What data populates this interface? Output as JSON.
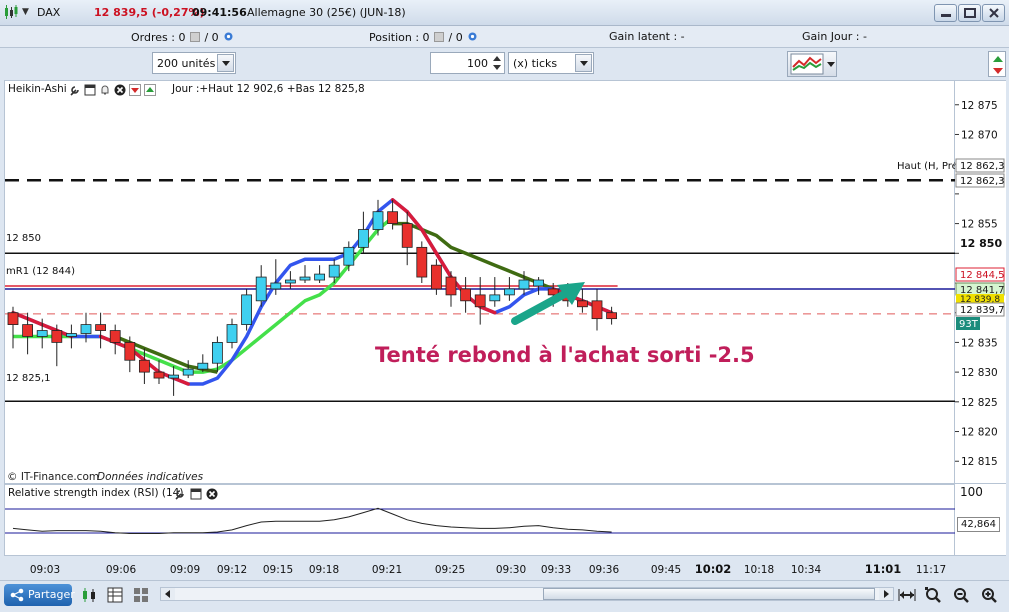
{
  "titlebar": {
    "symbol": "DAX",
    "price": "12 839,5 (-0,27%)",
    "time": "09:41:56",
    "instrument": "Allemagne 30 (25€) (JUN-18)"
  },
  "status": {
    "orders_label": "Ordres :",
    "orders_value": "0",
    "orders_sep": "/",
    "orders_value2": "0",
    "position_label": "Position :",
    "position_value": "0",
    "position_sep": "/",
    "position_value2": "0",
    "latent_label": "Gain latent :",
    "latent_value": "-",
    "day_label": "Gain Jour :",
    "day_value": "-"
  },
  "toolbar": {
    "units": "200 unités",
    "quantity": "100",
    "ticks": "(x) ticks"
  },
  "chart": {
    "indicator_name": "Heikin-Ashi",
    "day_info": "Jour :+Haut 12 902,6 +Bas 12 825,8",
    "copyright": "© IT-Finance.com",
    "data_note": "Données indicatives",
    "annotation": "Tenté rebond à l'achat sorti -2.5",
    "level_high_label": "Haut (H, Pré)",
    "level_12850_label": "12 850",
    "level_mr1_label": "mR1 (12 844)",
    "level_12825_label": "12 825,1"
  },
  "price_axis": {
    "ticks": [
      "12 875",
      "12 870",
      "12 865",
      "12 860",
      "12 855",
      "12 850",
      "12 845",
      "12 840",
      "12 835",
      "12 830",
      "12 825",
      "12 820",
      "12 815"
    ],
    "tag_high": "12 862,3",
    "tag_high2": "12 862,3",
    "tag_12850": "12 850",
    "tag_mr1": "12 844,5",
    "tag_green": "12 841,7",
    "tag_yellow": "12 839,8",
    "tag_last": "12 839,7",
    "tag_93t": "93T"
  },
  "rsi": {
    "label": "Relative strength index (RSI) (14)",
    "scale_top": "100",
    "value": "42,864"
  },
  "time_axis": {
    "labels": [
      "09:03",
      "09:06",
      "09:09",
      "09:12",
      "09:15",
      "09:18",
      "09:21",
      "09:25",
      "09:30",
      "09:33",
      "09:36",
      "09:45",
      "10:02",
      "10:18",
      "10:34",
      "11:01",
      "11:17"
    ],
    "bold": [
      "10:02",
      "11:01"
    ]
  },
  "bottombar": {
    "share_label": "Partager"
  },
  "chart_data": {
    "type": "candlestick",
    "ylim": [
      12811,
      12879
    ],
    "levels": [
      {
        "name": "Haut (H, Pré)",
        "value": 12862.3,
        "style": "dashed",
        "color": "#111111"
      },
      {
        "name": "12 850",
        "value": 12850,
        "style": "solid",
        "color": "#111111"
      },
      {
        "name": "mR1 (12 844)",
        "value": 12844.5,
        "style": "solid",
        "color": "#dd2233"
      },
      {
        "name": "blue",
        "value": 12844,
        "style": "solid",
        "color": "#1a1a9a"
      },
      {
        "name": "last",
        "value": 12839.8,
        "style": "dashed",
        "color": "#e05a5a"
      },
      {
        "name": "12 825,1",
        "value": 12825.1,
        "style": "solid",
        "color": "#111111"
      }
    ],
    "candles": [
      {
        "o": 12840,
        "c": 12838,
        "h": 12841,
        "l": 12834,
        "up": false
      },
      {
        "o": 12838,
        "c": 12836,
        "h": 12840,
        "l": 12833,
        "up": false
      },
      {
        "o": 12836,
        "c": 12837,
        "h": 12839,
        "l": 12834,
        "up": true
      },
      {
        "o": 12837,
        "c": 12835,
        "h": 12838,
        "l": 12831,
        "up": false
      },
      {
        "o": 12836,
        "c": 12836.5,
        "h": 12838,
        "l": 12834,
        "up": true
      },
      {
        "o": 12836.5,
        "c": 12838,
        "h": 12840,
        "l": 12835,
        "up": true
      },
      {
        "o": 12838,
        "c": 12837,
        "h": 12840,
        "l": 12834,
        "up": false
      },
      {
        "o": 12837,
        "c": 12835,
        "h": 12838,
        "l": 12833,
        "up": false
      },
      {
        "o": 12835,
        "c": 12832,
        "h": 12836,
        "l": 12830,
        "up": false
      },
      {
        "o": 12832,
        "c": 12830,
        "h": 12834,
        "l": 12828,
        "up": false
      },
      {
        "o": 12830,
        "c": 12829,
        "h": 12832,
        "l": 12828,
        "up": false
      },
      {
        "o": 12829,
        "c": 12829.5,
        "h": 12831,
        "l": 12826,
        "up": true
      },
      {
        "o": 12829.5,
        "c": 12830.5,
        "h": 12832,
        "l": 12829,
        "up": true
      },
      {
        "o": 12830.5,
        "c": 12831.5,
        "h": 12833,
        "l": 12830,
        "up": true
      },
      {
        "o": 12831.5,
        "c": 12835,
        "h": 12836,
        "l": 12830,
        "up": true
      },
      {
        "o": 12835,
        "c": 12838,
        "h": 12839,
        "l": 12834,
        "up": true
      },
      {
        "o": 12838,
        "c": 12843,
        "h": 12844,
        "l": 12837,
        "up": true
      },
      {
        "o": 12842,
        "c": 12846,
        "h": 12848,
        "l": 12841,
        "up": true
      },
      {
        "o": 12844,
        "c": 12845,
        "h": 12849,
        "l": 12843,
        "up": true
      },
      {
        "o": 12845,
        "c": 12845.5,
        "h": 12847,
        "l": 12844,
        "up": true
      },
      {
        "o": 12845.5,
        "c": 12846,
        "h": 12848,
        "l": 12845,
        "up": true
      },
      {
        "o": 12845.5,
        "c": 12846.5,
        "h": 12848,
        "l": 12845,
        "up": true
      },
      {
        "o": 12846,
        "c": 12848,
        "h": 12849,
        "l": 12845,
        "up": true
      },
      {
        "o": 12848,
        "c": 12851,
        "h": 12852,
        "l": 12847,
        "up": true
      },
      {
        "o": 12851,
        "c": 12854,
        "h": 12857,
        "l": 12850,
        "up": true
      },
      {
        "o": 12854,
        "c": 12857,
        "h": 12859,
        "l": 12853,
        "up": true
      },
      {
        "o": 12857,
        "c": 12855,
        "h": 12859,
        "l": 12854,
        "up": false
      },
      {
        "o": 12855,
        "c": 12851,
        "h": 12857,
        "l": 12848,
        "up": false
      },
      {
        "o": 12851,
        "c": 12846,
        "h": 12852,
        "l": 12845,
        "up": false
      },
      {
        "o": 12848,
        "c": 12844,
        "h": 12849,
        "l": 12843,
        "up": false
      },
      {
        "o": 12846,
        "c": 12843,
        "h": 12847,
        "l": 12841,
        "up": false
      },
      {
        "o": 12844,
        "c": 12842,
        "h": 12846,
        "l": 12840,
        "up": false
      },
      {
        "o": 12843,
        "c": 12841,
        "h": 12846,
        "l": 12838,
        "up": false
      },
      {
        "o": 12842,
        "c": 12843,
        "h": 12846,
        "l": 12841,
        "up": true
      },
      {
        "o": 12843,
        "c": 12844,
        "h": 12846,
        "l": 12842,
        "up": true
      },
      {
        "o": 12844,
        "c": 12845.5,
        "h": 12847,
        "l": 12843,
        "up": true
      },
      {
        "o": 12845.5,
        "c": 12844.5,
        "h": 12846,
        "l": 12843,
        "up": true
      },
      {
        "o": 12844,
        "c": 12843,
        "h": 12845,
        "l": 12841,
        "up": false
      },
      {
        "o": 12843,
        "c": 12842,
        "h": 12845,
        "l": 12841,
        "up": false
      },
      {
        "o": 12842,
        "c": 12841,
        "h": 12844,
        "l": 12840,
        "up": false
      },
      {
        "o": 12842,
        "c": 12839,
        "h": 12844,
        "l": 12837,
        "up": false
      },
      {
        "o": 12840,
        "c": 12839,
        "h": 12841,
        "l": 12838,
        "up": false
      }
    ],
    "series": [
      {
        "name": "green-ma",
        "color": "#44e04a",
        "values": [
          12836,
          12836,
          12836,
          12836,
          12836,
          12836,
          12836,
          12835,
          12834,
          12833,
          12832,
          12831,
          12830,
          12830,
          12830.5,
          12832,
          12834,
          12836,
          12838,
          12840,
          12842,
          12843,
          12845,
          12848,
          12851,
          12854,
          12856,
          null,
          null,
          null,
          null,
          null,
          null,
          null,
          null,
          null,
          null,
          null,
          null,
          null,
          null,
          null
        ]
      },
      {
        "name": "darkgreen-ma",
        "color": "#3f6b12",
        "values": [
          null,
          null,
          null,
          null,
          null,
          null,
          null,
          12836,
          12835,
          12834,
          12833,
          12832,
          12831,
          12830.5,
          12830,
          null,
          null,
          null,
          null,
          null,
          null,
          null,
          null,
          null,
          null,
          null,
          12855,
          12855,
          12854,
          12853,
          12851,
          12850,
          12849,
          12848,
          12847,
          12846,
          12845,
          12844,
          12843,
          12842,
          12841,
          null
        ]
      },
      {
        "name": "red-blue-ma",
        "color": "#3355ee",
        "values": [
          12840,
          12839,
          12838,
          12837,
          12836,
          12836,
          12836,
          12835,
          12834,
          12832,
          12830,
          12829,
          12828,
          12828,
          12829,
          12832,
          12836,
          12841,
          12845,
          12848,
          12849,
          12849,
          12849,
          12850,
          12853,
          12857,
          12859,
          12857,
          12854,
          12850,
          12846,
          12843,
          12841,
          12840,
          12841,
          12843,
          12844,
          12844,
          12843,
          12842,
          12841,
          12840
        ]
      }
    ],
    "rsi_values": [
      48,
      46,
      44,
      45,
      45,
      45,
      44,
      42,
      41,
      41,
      41,
      42,
      42,
      42,
      43,
      46,
      52,
      57,
      58,
      58,
      58,
      58,
      60,
      64,
      70,
      76,
      68,
      60,
      55,
      52,
      50,
      49,
      48,
      48,
      49,
      51,
      52,
      49,
      47,
      46,
      44,
      43
    ]
  }
}
